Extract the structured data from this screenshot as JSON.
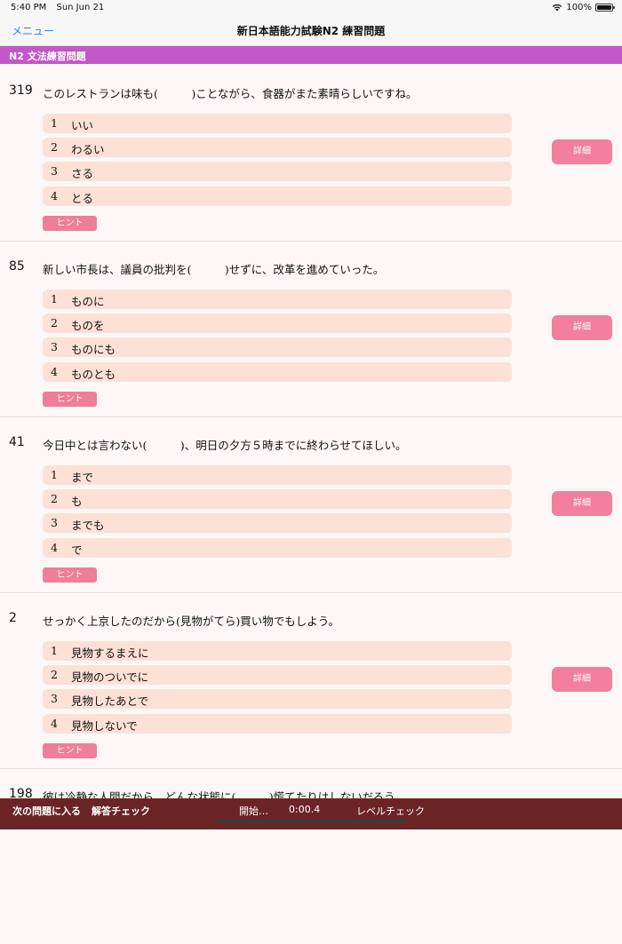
{
  "status_bar": {
    "time": "5:40 PM",
    "date": "Sun Jun 21",
    "battery": "100%"
  },
  "nav": {
    "menu_label": "メニュー",
    "title": "新日本語能力試験N2 練習問題"
  },
  "section_title": "N2 文法練習問題",
  "hint_label": "ヒント",
  "detail_label": "詳細",
  "questions": [
    {
      "number": "319",
      "text": "このレストランは味も(　　　)ことながら、食器がまた素晴らしいですね。",
      "options": [
        {
          "num": "1",
          "text": "いい"
        },
        {
          "num": "2",
          "text": "わるい"
        },
        {
          "num": "3",
          "text": "さる"
        },
        {
          "num": "4",
          "text": "とる"
        }
      ]
    },
    {
      "number": "85",
      "text": "新しい市長は、議員の批判を(　　　)せずに、改革を進めていった。",
      "options": [
        {
          "num": "1",
          "text": "ものに"
        },
        {
          "num": "2",
          "text": "ものを"
        },
        {
          "num": "3",
          "text": "ものにも"
        },
        {
          "num": "4",
          "text": "ものとも"
        }
      ]
    },
    {
      "number": "41",
      "text": "今日中とは言わない(　　　)、明日の夕方５時までに終わらせてほしい。",
      "options": [
        {
          "num": "1",
          "text": "まで"
        },
        {
          "num": "2",
          "text": "も"
        },
        {
          "num": "3",
          "text": "までも"
        },
        {
          "num": "4",
          "text": "で"
        }
      ]
    },
    {
      "number": "2",
      "text": "せっかく上京したのだから(見物がてら)買い物でもしよう。",
      "options": [
        {
          "num": "1",
          "text": "見物するまえに"
        },
        {
          "num": "2",
          "text": "見物のついでに"
        },
        {
          "num": "3",
          "text": "見物したあとで"
        },
        {
          "num": "4",
          "text": "見物しないで"
        }
      ]
    },
    {
      "number": "198",
      "text": "彼は冷静な人間だから、どんな状態に(　　　)慌てたりはしないだろう。"
    }
  ],
  "bottom_bar": {
    "next_question": "次の問題に入る",
    "check_answer": "解答チェック",
    "start": "開始…",
    "timer": "0:00.4",
    "level_check": "レベルチェック"
  },
  "colors": {
    "section_header": "#c158c5",
    "option_bg": "#fde1d6",
    "detail_button": "#f27f9d",
    "hint_button": "#ef7e98",
    "bottom_bar": "#6b2426",
    "menu_link": "#2f7cf6"
  }
}
